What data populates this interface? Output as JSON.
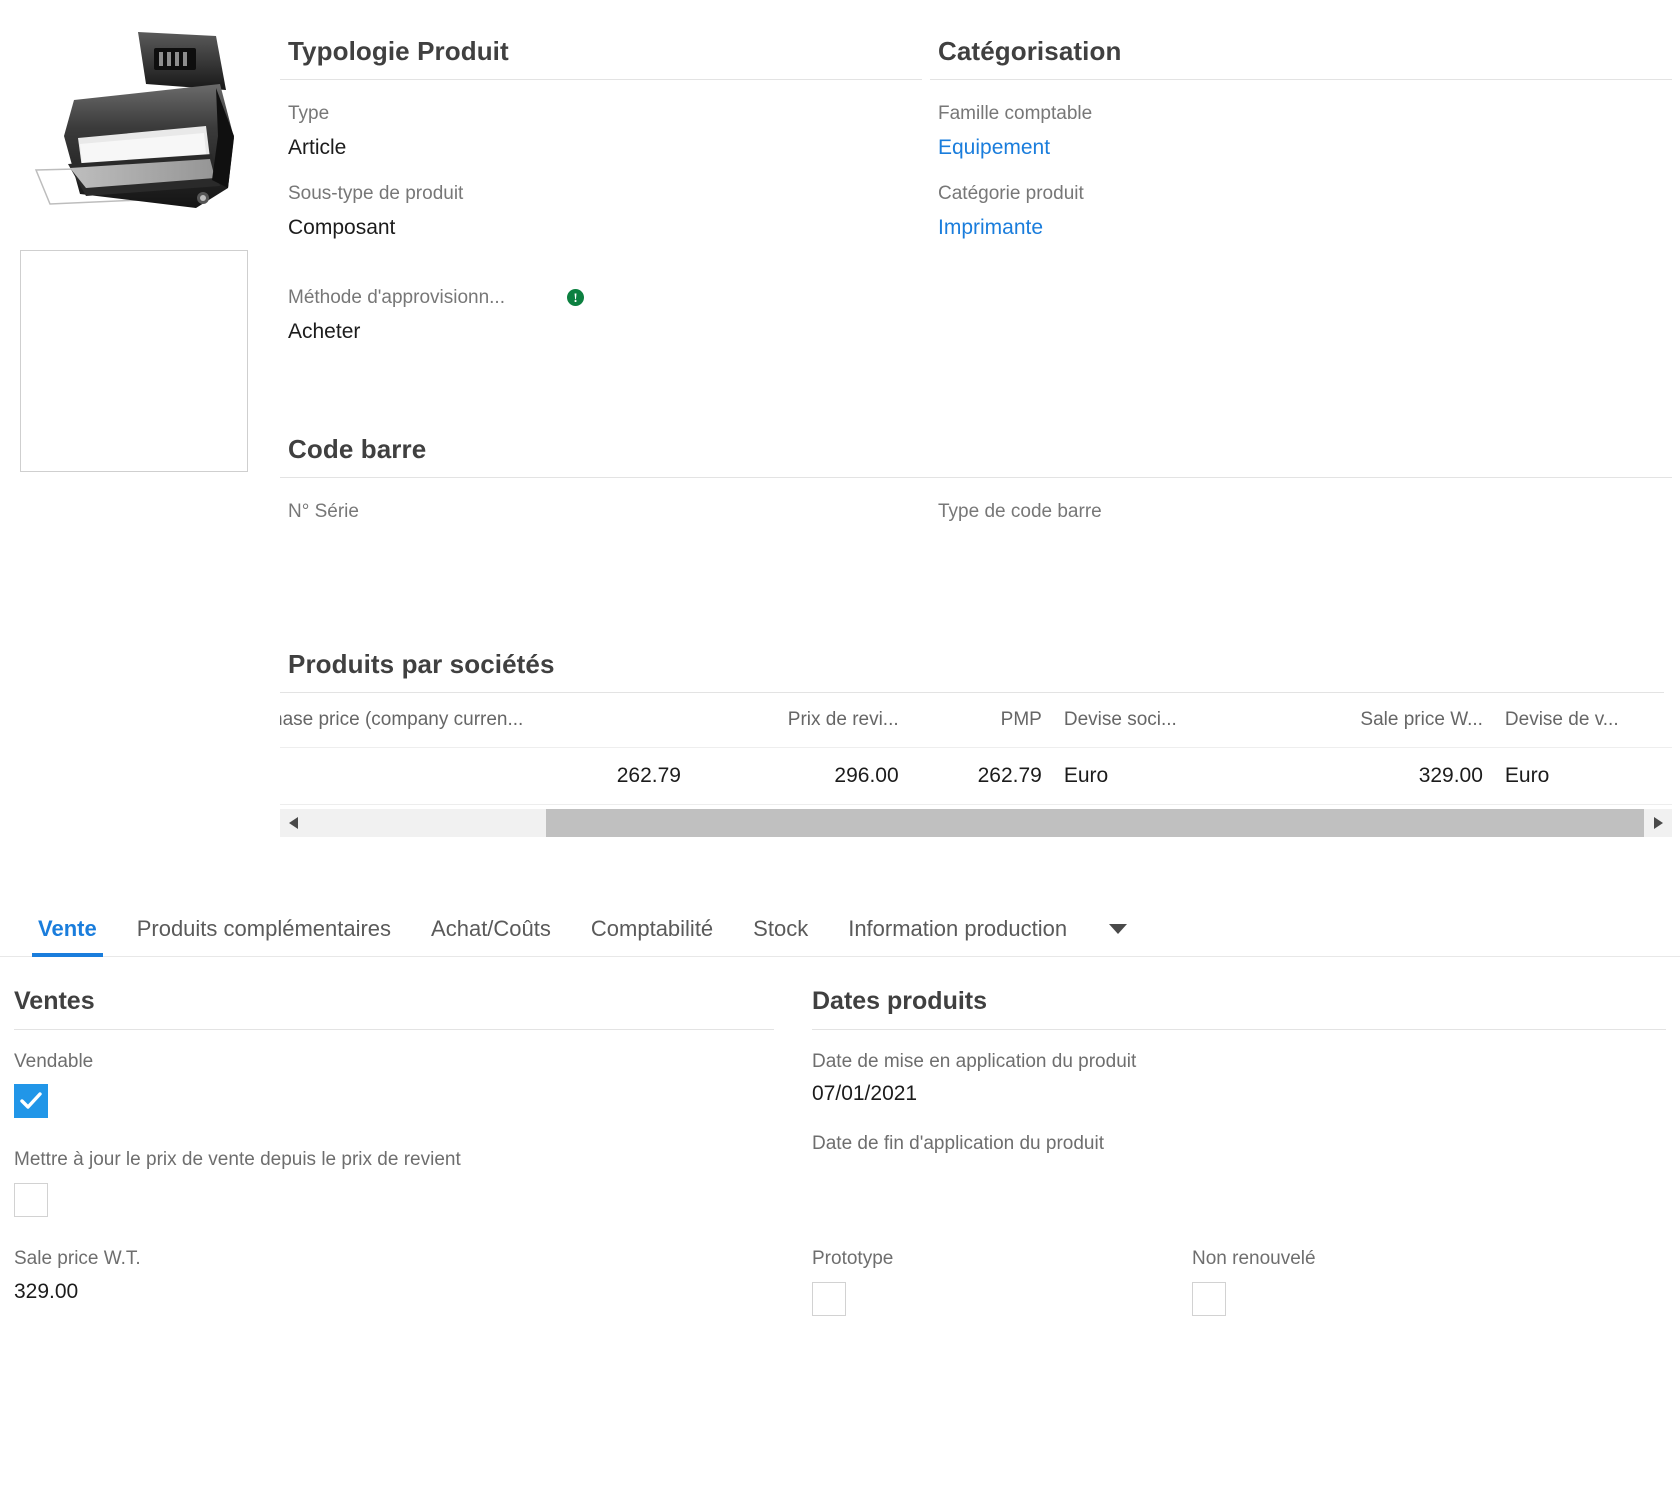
{
  "media": {
    "product_image_alt": "printer-illustration",
    "placeholder_alt": "empty-image-placeholder"
  },
  "typology": {
    "title": "Typologie Produit",
    "fields": [
      {
        "label": "Type",
        "value": "Article"
      },
      {
        "label": "Sous-type de produit",
        "value": "Composant"
      },
      {
        "label": "Méthode d'approvisionn...",
        "value": "Acheter",
        "has_warning": true
      }
    ]
  },
  "categorisation": {
    "title": "Catégorisation",
    "fields": [
      {
        "label": "Famille comptable",
        "value": "Equipement",
        "is_link": true
      },
      {
        "label": "Catégorie produit",
        "value": "Imprimante",
        "is_link": true
      }
    ]
  },
  "barcode": {
    "title": "Code barre",
    "serial_label": "N° Série",
    "serial_value": "",
    "type_label": "Type de code barre",
    "type_value": ""
  },
  "companies": {
    "title": "Produits par sociétés",
    "columns": [
      "hase price (company curren...",
      "Prix de revi...",
      "PMP",
      "Devise soci...",
      "Sale price W...",
      "Devise de v..."
    ],
    "rows": [
      {
        "purchase_price": "262.79",
        "cost_price": "296.00",
        "pmp": "262.79",
        "company_currency": "Euro",
        "sale_price_wt": "329.00",
        "sale_currency": "Euro"
      }
    ],
    "scroll_left_icon": "scroll-left-arrow",
    "scroll_right_icon": "scroll-right-arrow"
  },
  "tabs": {
    "items": [
      {
        "label": "Vente",
        "active": true
      },
      {
        "label": "Produits complémentaires",
        "active": false
      },
      {
        "label": "Achat/Coûts",
        "active": false
      },
      {
        "label": "Comptabilité",
        "active": false
      },
      {
        "label": "Stock",
        "active": false
      },
      {
        "label": "Information production",
        "active": false
      }
    ],
    "more_icon": "chevron-down-icon"
  },
  "ventes": {
    "title": "Ventes",
    "vendable_label": "Vendable",
    "vendable_checked": true,
    "update_price_label": "Mettre à jour le prix de vente depuis le prix de revient",
    "update_price_checked": false,
    "sale_price_label": "Sale price W.T.",
    "sale_price_value": "329.00"
  },
  "dates_produits": {
    "title": "Dates produits",
    "start_label": "Date de mise en application du produit",
    "start_value": "07/01/2021",
    "end_label": "Date de fin d'application du produit",
    "end_value": "",
    "prototype_label": "Prototype",
    "prototype_checked": false,
    "non_renewed_label": "Non renouvelé",
    "non_renewed_checked": false
  },
  "colors": {
    "link": "#1a7ddc",
    "accent": "#1a7ddc",
    "checkbox_on": "#2196e8",
    "warning": "#0c8040"
  }
}
